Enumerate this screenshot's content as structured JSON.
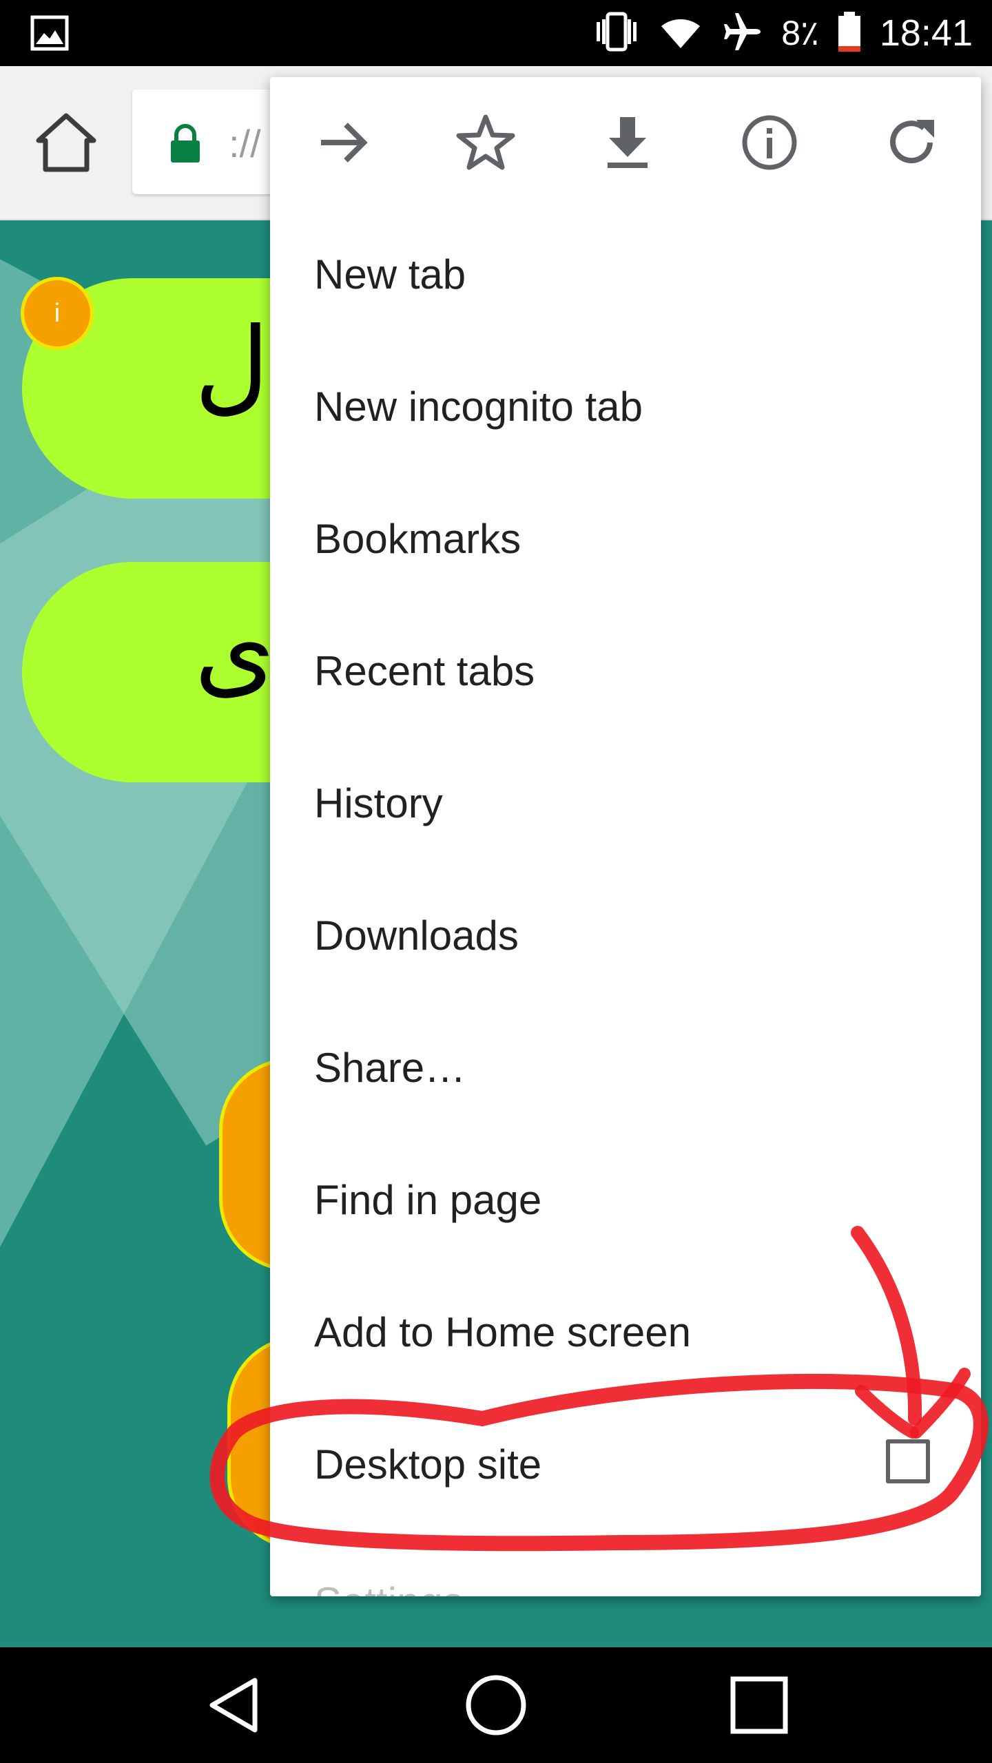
{
  "status_bar": {
    "battery_percent": "8٪",
    "time": "18:41",
    "icons": [
      "gallery-notification-icon",
      "vibrate-icon",
      "wifi-icon",
      "airplane-mode-icon",
      "battery-icon"
    ]
  },
  "toolbar": {
    "url_fragment": "://",
    "icons": [
      "home-icon",
      "lock-icon"
    ]
  },
  "web_content": {
    "pill1_text": "ل",
    "pill2_text": "ی",
    "badge_text": "i"
  },
  "menu": {
    "top_icons": [
      "forward-icon",
      "bookmark-star-icon",
      "download-icon",
      "info-icon",
      "reload-icon"
    ],
    "items": [
      {
        "label": "New tab"
      },
      {
        "label": "New incognito tab"
      },
      {
        "label": "Bookmarks"
      },
      {
        "label": "Recent tabs"
      },
      {
        "label": "History"
      },
      {
        "label": "Downloads"
      },
      {
        "label": "Share…"
      },
      {
        "label": "Find in page"
      },
      {
        "label": "Add to Home screen"
      },
      {
        "label": "Desktop site",
        "checked": false
      }
    ],
    "peek_label": "Settings"
  },
  "annotation": {
    "color": "#ee1c24"
  },
  "nav_bar": {
    "icons": [
      "back-icon",
      "home-circle-icon",
      "recents-icon"
    ]
  }
}
